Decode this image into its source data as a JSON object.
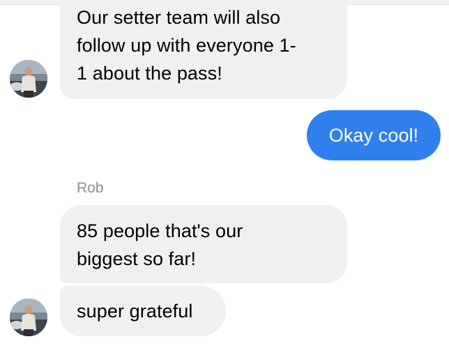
{
  "messages": [
    {
      "id": "m1",
      "direction": "incoming",
      "lines": [
        "Our setter team will also",
        "follow up with everyone 1-",
        "1 about the pass!"
      ]
    },
    {
      "id": "m2",
      "direction": "outgoing",
      "text": "Okay cool!"
    },
    {
      "id": "m3",
      "direction": "incoming",
      "sender": "Rob",
      "lines": [
        "85 people that's our",
        "biggest so far!"
      ]
    },
    {
      "id": "m4",
      "direction": "incoming",
      "text": "super grateful"
    }
  ],
  "colors": {
    "incoming_bubble": "#f0f0f2",
    "outgoing_bubble": "#2f80ec",
    "sender_label": "#8e8e93"
  },
  "icons": {
    "avatar": "user-avatar-photo"
  }
}
